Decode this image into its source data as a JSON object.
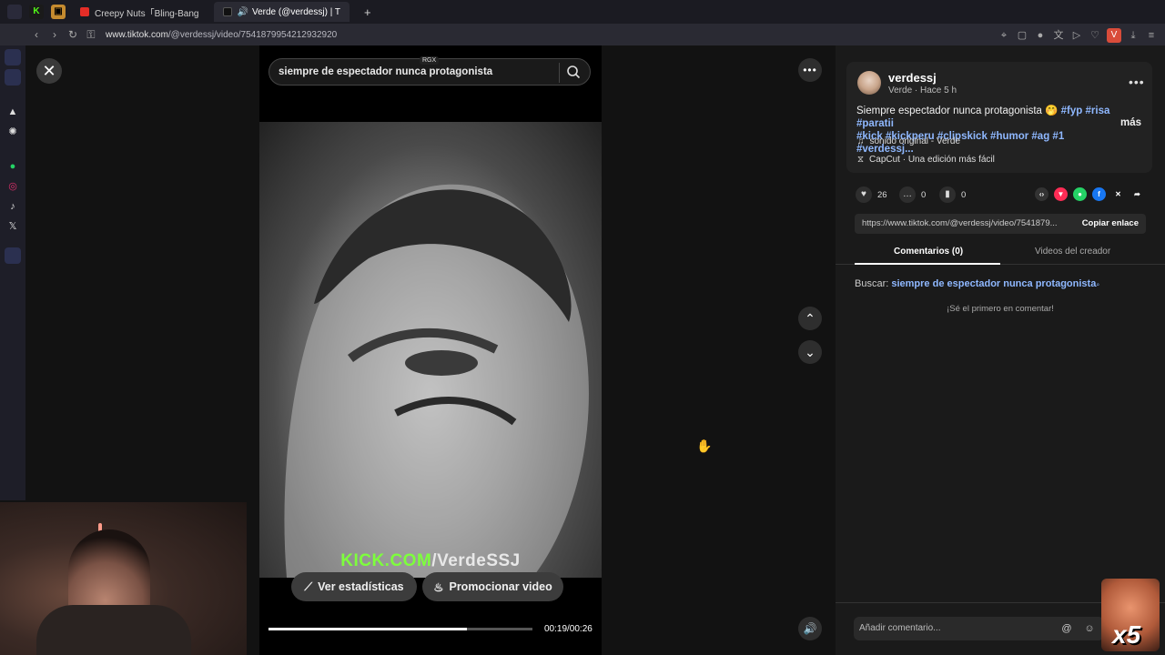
{
  "browser": {
    "tabs": [
      {
        "label": "Creepy Nuts「Bling-Bang",
        "active": false
      },
      {
        "label": "Verde (@verdessj) | T",
        "active": true
      }
    ],
    "url_host": "www.tiktok.com",
    "url_path": "/@verdessj/video/7541879954212932920",
    "profile_initial": "V"
  },
  "video": {
    "search_query": "siempre de espectador nunca protagonista",
    "badge": "RGX",
    "watermark_kick": "KICK.COM",
    "watermark_rest": "/VerdeSSJ",
    "stats_button": "Ver estadísticas",
    "promote_button": "Promocionar video",
    "time": "00:19/00:26",
    "progress": 0.75
  },
  "post": {
    "username": "verdessj",
    "subline": "Verde · Hace 5 h",
    "description_text": "Siempre espectador nunca protagonista 🤭 ",
    "hashtags_line1": "#fyp #risa #paratii",
    "hashtags_line2": "#kick #kickperu #clipskick #humor #ag #1 #verdessj...",
    "more": "más",
    "sound": "sonido original - Verde",
    "capcut": "CapCut · Una edición más fácil",
    "likes": "26",
    "comments": "0",
    "saves": "0",
    "link": "https://www.tiktok.com/@verdessj/video/7541879...",
    "copy_link": "Copiar enlace"
  },
  "panel": {
    "tab_comments": "Comentarios (0)",
    "tab_creator": "Videos del creador",
    "search_label": "Buscar:",
    "search_term": "siempre de espectador nunca protagonista",
    "first_comment": "¡Sé el primero en comentar!",
    "comment_placeholder": "Añadir comentario..."
  },
  "overlay": {
    "emote_text": "x5"
  },
  "colors": {
    "accent_link": "#8fb8ff",
    "kick_green": "#7dff3c"
  }
}
